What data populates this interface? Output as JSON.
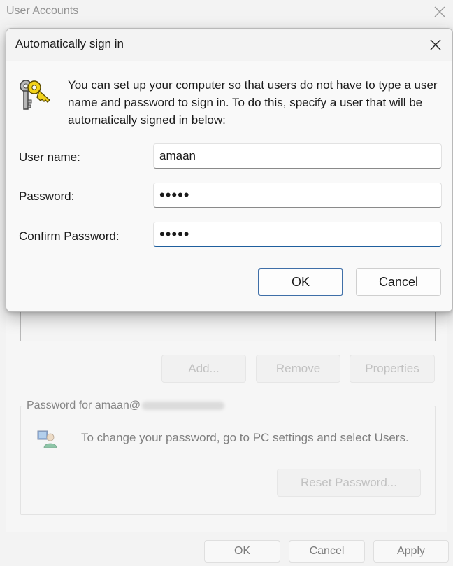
{
  "background_window": {
    "title": "User Accounts",
    "buttons": {
      "add": "Add...",
      "remove": "Remove",
      "properties": "Properties"
    },
    "password_group": {
      "legend": "Password for amaan@",
      "text": "To change your password, go to PC settings and select Users.",
      "reset_button": "Reset Password..."
    },
    "footer": {
      "ok": "OK",
      "cancel": "Cancel",
      "apply": "Apply"
    }
  },
  "dialog": {
    "title": "Automatically sign in",
    "intro": "You can set up your computer so that users do not have to type a user name and password to sign in. To do this, specify a user that will be automatically signed in below:",
    "fields": {
      "username": {
        "label": "User name:",
        "value": "amaan"
      },
      "password": {
        "label": "Password:",
        "value": "•••••"
      },
      "confirm_password": {
        "label": "Confirm Password:",
        "value": "•••••"
      }
    },
    "buttons": {
      "ok": "OK",
      "cancel": "Cancel"
    }
  },
  "colors": {
    "accent": "#1f5f9e",
    "default_button_border": "#3f6fa8"
  },
  "icons": {
    "dialog_icon": "keys-icon",
    "group_icon": "user-account-icon",
    "close": "close-icon"
  }
}
